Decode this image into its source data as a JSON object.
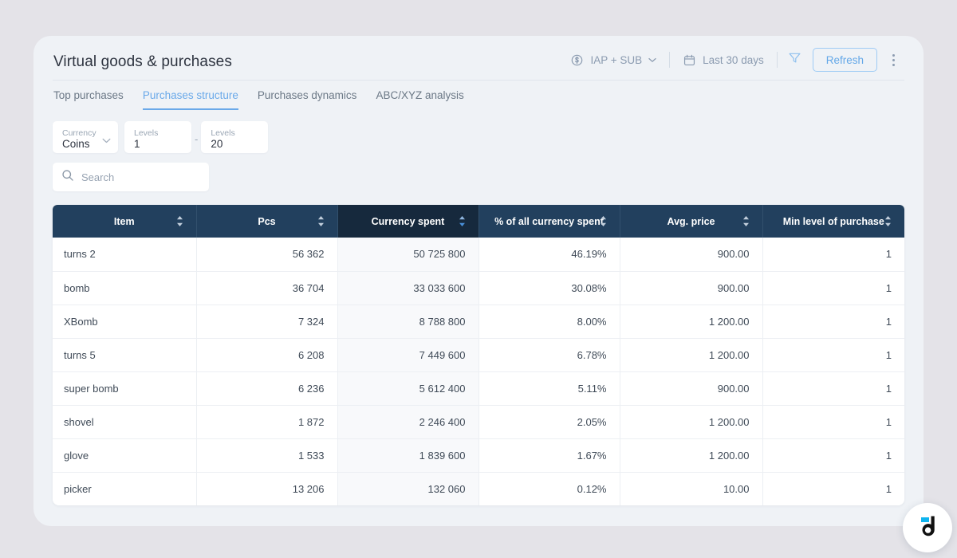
{
  "header": {
    "title": "Virtual goods & purchases",
    "product_filter": {
      "label": "IAP + SUB",
      "icon": "dollar-circle-icon"
    },
    "date_filter": {
      "label": "Last 30 days",
      "icon": "calendar-icon"
    },
    "filter_icon": "funnel-icon",
    "refresh_label": "Refresh",
    "more_icon": "kebab-menu-icon"
  },
  "tabs": [
    {
      "label": "Top purchases",
      "active": false
    },
    {
      "label": "Purchases structure",
      "active": true
    },
    {
      "label": "Purchases dynamics",
      "active": false
    },
    {
      "label": "ABC/XYZ analysis",
      "active": false
    }
  ],
  "filters": {
    "currency": {
      "label": "Currency",
      "value": "Coins"
    },
    "level_from": {
      "label": "Levels",
      "value": "1"
    },
    "separator": "-",
    "level_to": {
      "label": "Levels",
      "value": "20"
    }
  },
  "search": {
    "placeholder": "Search",
    "value": "",
    "icon": "search-icon"
  },
  "table": {
    "columns": [
      {
        "label": "Item",
        "align": "center",
        "sorted": false
      },
      {
        "label": "Pcs",
        "align": "center",
        "sorted": false
      },
      {
        "label": "Currency spent",
        "align": "center",
        "sorted": true
      },
      {
        "label": "% of all currency spent",
        "align": "center",
        "sorted": false
      },
      {
        "label": "Avg. price",
        "align": "center",
        "sorted": false
      },
      {
        "label": "Min level of purchase",
        "align": "center",
        "sorted": false
      }
    ],
    "rows": [
      {
        "item": "turns 2",
        "pcs": "56 362",
        "currency_spent": "50 725 800",
        "pct": "46.19%",
        "avg_price": "900.00",
        "min_level": "1"
      },
      {
        "item": "bomb",
        "pcs": "36 704",
        "currency_spent": "33 033 600",
        "pct": "30.08%",
        "avg_price": "900.00",
        "min_level": "1"
      },
      {
        "item": "XBomb",
        "pcs": "7 324",
        "currency_spent": "8 788 800",
        "pct": "8.00%",
        "avg_price": "1 200.00",
        "min_level": "1"
      },
      {
        "item": "turns 5",
        "pcs": "6 208",
        "currency_spent": "7 449 600",
        "pct": "6.78%",
        "avg_price": "1 200.00",
        "min_level": "1"
      },
      {
        "item": "super bomb",
        "pcs": "6 236",
        "currency_spent": "5 612 400",
        "pct": "5.11%",
        "avg_price": "900.00",
        "min_level": "1"
      },
      {
        "item": "shovel",
        "pcs": "1 872",
        "currency_spent": "2 246 400",
        "pct": "2.05%",
        "avg_price": "1 200.00",
        "min_level": "1"
      },
      {
        "item": "glove",
        "pcs": "1 533",
        "currency_spent": "1 839 600",
        "pct": "1.67%",
        "avg_price": "1 200.00",
        "min_level": "1"
      },
      {
        "item": "picker",
        "pcs": "13 206",
        "currency_spent": "132 060",
        "pct": "0.12%",
        "avg_price": "10.00",
        "min_level": "1"
      }
    ]
  },
  "chat_widget": {
    "icon": "devtodev-logo-icon"
  },
  "colors": {
    "page_background": "#e4e3e8",
    "card_background": "#eff2f6",
    "table_header": "#22405e",
    "table_header_sorted": "#16293d",
    "accent_blue": "#6aa9e9",
    "logo_cyan": "#0fb4ef"
  }
}
